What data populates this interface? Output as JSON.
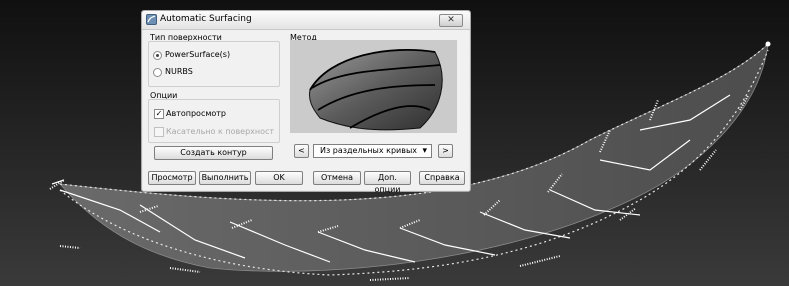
{
  "dialog": {
    "title": "Automatic Surfacing",
    "close_glyph": "✕",
    "surface_type": {
      "label": "Тип поверхности",
      "options": [
        "PowerSurface(s)",
        "NURBS"
      ],
      "selected": "PowerSurface(s)"
    },
    "method": {
      "label": "Метод",
      "prev_glyph": "<",
      "next_glyph": ">",
      "selected": "Из раздельных кривых",
      "dropdown_glyph": "▾"
    },
    "options": {
      "label": "Опции",
      "autopreview": "Автопросмотр",
      "autopreview_checked": true,
      "tangent": "Касательно к поверхност",
      "tangent_enabled": false
    },
    "create_contour": "Создать контур",
    "buttons": {
      "preview": "Просмотр",
      "apply": "Выполнить",
      "ok": "OK",
      "cancel": "Отмена",
      "extra": "Доп. опции",
      "help": "Справка"
    }
  },
  "colors": {
    "background": "#1f1f1f",
    "surface_patch": "#5f5f5f",
    "curve": "#ffffff"
  }
}
